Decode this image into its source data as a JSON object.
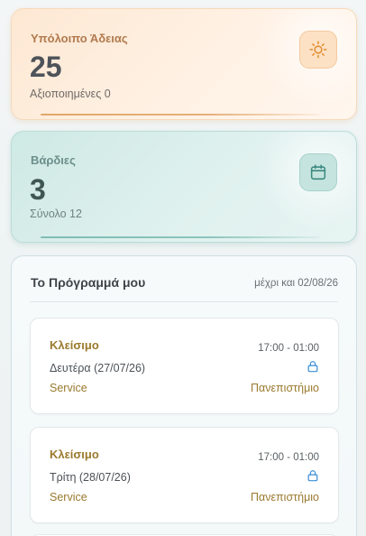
{
  "colors": {
    "leave_accent": "#e0a869",
    "shifts_accent": "#7fbdb4",
    "shift_type_text": "#9a7a2e"
  },
  "leave_card": {
    "title": "Υπόλοιπο Άδειας",
    "value": "25",
    "subtitle": "Αξιοποιημένες 0",
    "icon": "sun-icon"
  },
  "shifts_card": {
    "title": "Βάρδιες",
    "value": "3",
    "subtitle": "Σύνολο 12",
    "icon": "calendar-icon"
  },
  "schedule": {
    "title": "Το Πρόγραμμά μου",
    "until_label": "μέχρι και 02/08/26",
    "shifts": [
      {
        "type": "Κλείσιμο",
        "date": "Δευτέρα (27/07/26)",
        "department": "Service",
        "time": "17:00 - 01:00",
        "location": "Πανεπιστήμιο",
        "icon": "lock-icon"
      },
      {
        "type": "Κλείσιμο",
        "date": "Τρίτη (28/07/26)",
        "department": "Service",
        "time": "17:00 - 01:00",
        "location": "Πανεπιστήμιο",
        "icon": "lock-icon"
      }
    ]
  }
}
